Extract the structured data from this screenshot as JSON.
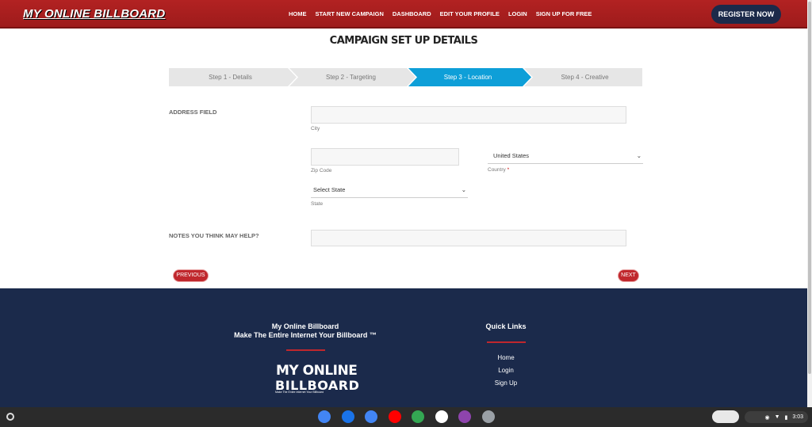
{
  "header": {
    "logo": "MY ONLINE BILLBOARD",
    "nav": [
      "HOME",
      "START NEW CAMPAIGN",
      "DASHBOARD",
      "EDIT YOUR PROFILE",
      "LOGIN",
      "SIGN UP FOR FREE"
    ],
    "register": "REGISTER NOW"
  },
  "page": {
    "title": "CAMPAIGN SET UP DETAILS"
  },
  "steps": [
    {
      "label": "Step 1 - Details",
      "state": "inactive"
    },
    {
      "label": "Step 2 - Targeting",
      "state": "inactive"
    },
    {
      "label": "Step 3 - Location",
      "state": "active"
    },
    {
      "label": "Step 4 - Creative",
      "state": "inactive"
    }
  ],
  "form": {
    "address_label": "ADDRESS FIELD",
    "city_value": "",
    "city_sub": "City",
    "zip_value": "",
    "zip_sub": "Zip Code",
    "country_value": "United States",
    "country_sub": "Country",
    "country_required": "*",
    "state_value": "Select State",
    "state_sub": "State",
    "notes_label": "NOTES YOU THINK MAY HELP?",
    "notes_value": "",
    "previous": "PREVIOUS",
    "next": "NEXT"
  },
  "footer": {
    "brand_line1": "My Online Billboard",
    "brand_line2": "Make The Entire Internet Your Billboard ™",
    "logo_line1": "MY ONLINE",
    "logo_line2": "BILLBOARD",
    "logo_tagline": "Make The Entire Internet Your Billboard",
    "quick_links_title": "Quick Links",
    "links": [
      "Home",
      "Login",
      "Sign Up"
    ]
  },
  "taskbar": {
    "apps": [
      "chrome-icon",
      "files-icon",
      "docs-icon",
      "youtube-icon",
      "play-store-icon",
      "play-movies-icon",
      "picsart-icon",
      "settings-app-icon"
    ],
    "app_colors": [
      "#4285f4",
      "#1a73e8",
      "#4285f4",
      "#ff0000",
      "#34a853",
      "#ffffff",
      "#8e44ad",
      "#9aa0a6"
    ],
    "time": "3:03"
  },
  "colors": {
    "accent_red": "#c0272d",
    "step_active": "#0e9fd8",
    "navy": "#1b2a4b"
  }
}
